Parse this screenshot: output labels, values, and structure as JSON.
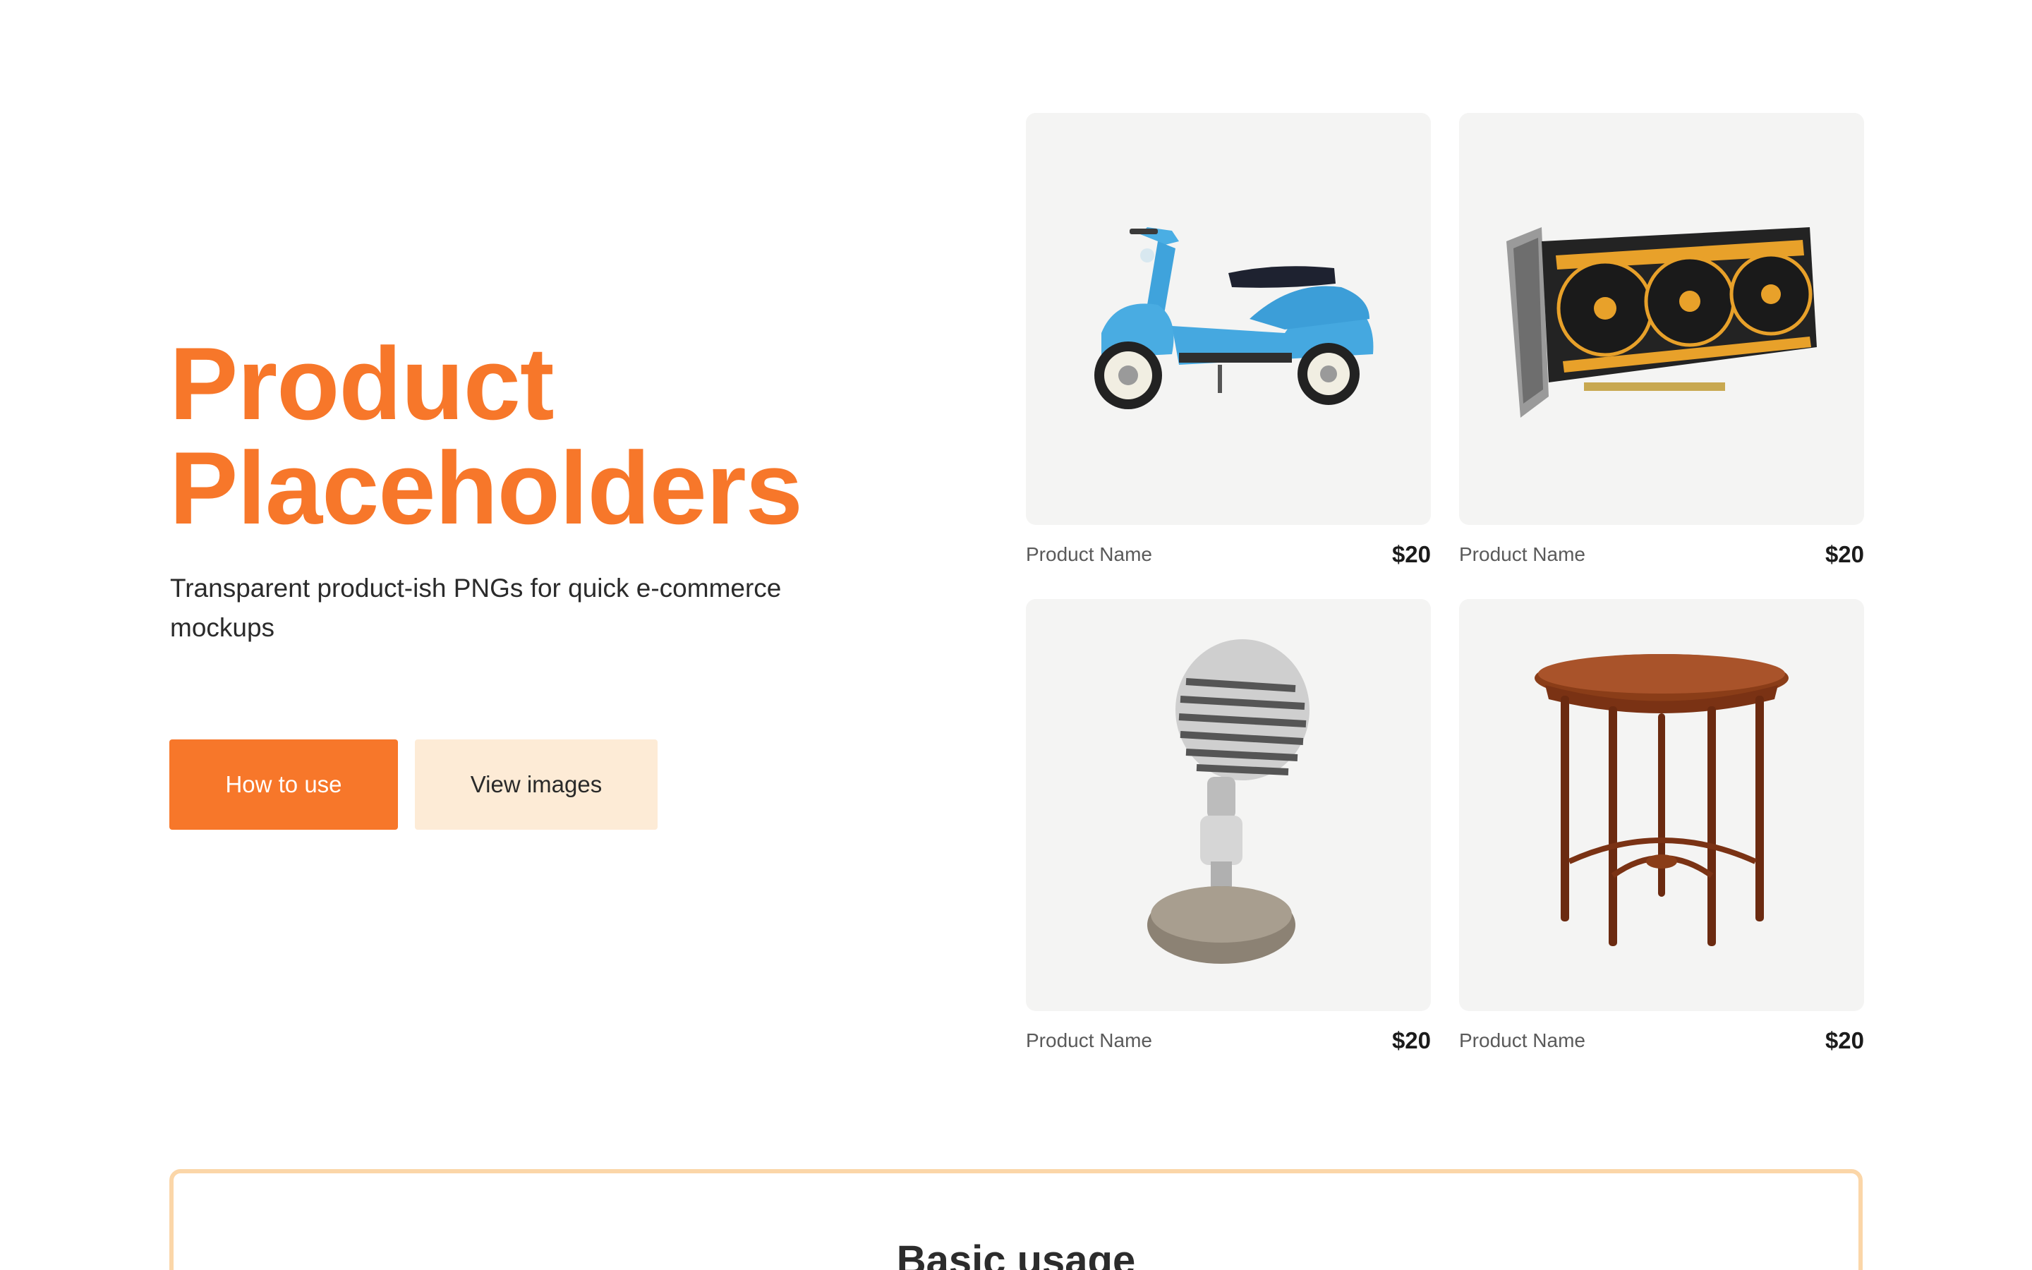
{
  "hero": {
    "title_line1": "Product",
    "title_line2": "Placeholders",
    "subtitle": "Transparent product-ish PNGs for quick e-commerce mockups"
  },
  "buttons": {
    "primary": "How to use",
    "secondary": "View images"
  },
  "products": [
    {
      "icon": "scooter-image",
      "name": "Product Name",
      "price": "$20"
    },
    {
      "icon": "graphics-card-image",
      "name": "Product Name",
      "price": "$20"
    },
    {
      "icon": "microphone-image",
      "name": "Product Name",
      "price": "$20"
    },
    {
      "icon": "side-table-image",
      "name": "Product Name",
      "price": "$20"
    }
  ],
  "usage": {
    "title": "Basic usage"
  },
  "colors": {
    "accent": "#f7772a",
    "accent_soft": "#fdebd6",
    "panel_border": "#fbd6a8",
    "card_bg": "#f4f4f3"
  }
}
